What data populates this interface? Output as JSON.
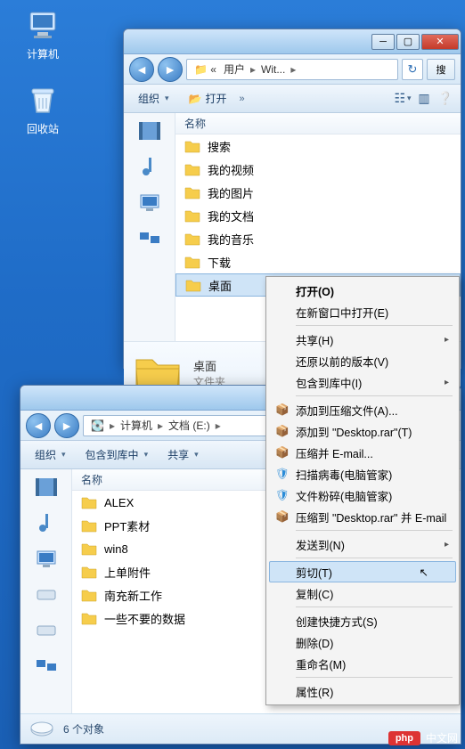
{
  "desktop": {
    "computer": "计算机",
    "recycle": "回收站"
  },
  "win_top": {
    "breadcrumb": {
      "seg1": "用户",
      "seg2": "Wit..."
    },
    "search": "搜",
    "toolbar": {
      "organize": "组织",
      "open": "打开"
    },
    "colhead": "名称",
    "items": {
      "0": "搜索",
      "1": "我的视频",
      "2": "我的图片",
      "3": "我的文档",
      "4": "我的音乐",
      "5": "下载",
      "6": "桌面"
    },
    "preview": {
      "name": "桌面",
      "type": "文件夹"
    }
  },
  "win_bot": {
    "breadcrumb": {
      "seg1": "计算机",
      "seg2": "文档 (E:)"
    },
    "toolbar": {
      "organize": "组织",
      "include": "包含到库中",
      "share": "共享"
    },
    "colhead": "名称",
    "items": {
      "0": "ALEX",
      "1": "PPT素材",
      "2": "win8",
      "3": "上单附件",
      "4": "南充新工作",
      "5": "一些不要的数据"
    },
    "status": "6 个对象"
  },
  "ctx": {
    "open": "打开(O)",
    "open_new_win": "在新窗口中打开(E)",
    "share": "共享(H)",
    "restore_prev": "还原以前的版本(V)",
    "include_lib": "包含到库中(I)",
    "add_archive": "添加到压缩文件(A)...",
    "add_desktop_rar": "添加到 \"Desktop.rar\"(T)",
    "compress_email": "压缩并 E-mail...",
    "scan_virus": "扫描病毒(电脑管家)",
    "shred": "文件粉碎(电脑管家)",
    "compress_send": "压缩到 \"Desktop.rar\" 并 E-mail",
    "send_to": "发送到(N)",
    "cut": "剪切(T)",
    "copy": "复制(C)",
    "shortcut": "创建快捷方式(S)",
    "delete": "删除(D)",
    "rename": "重命名(M)",
    "properties": "属性(R)"
  },
  "watermark": {
    "badge": "php",
    "text": "中文网"
  }
}
